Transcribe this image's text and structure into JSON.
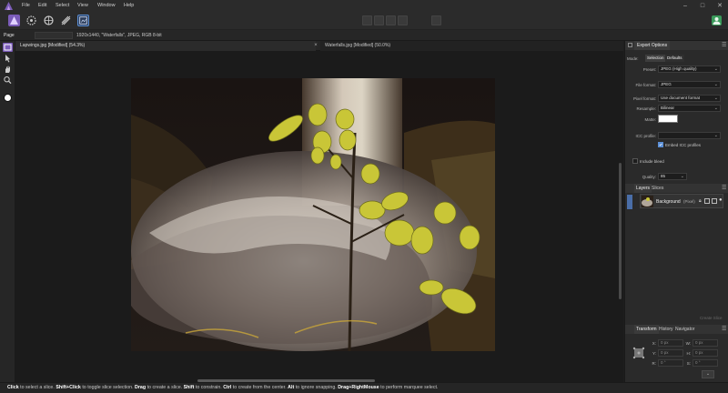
{
  "menu": {
    "items": [
      "File",
      "Edit",
      "Select",
      "View",
      "Window",
      "Help"
    ]
  },
  "window_controls": {
    "minimize": "–",
    "maximize": "□",
    "close": "✕"
  },
  "context_bar": {
    "persona_label": "Page",
    "document_info": "1920x1440, \"Waterfalls\", JPEG, RGB 8-bit"
  },
  "documents": {
    "tabs": [
      {
        "label": "Lapwings.jpg [Modified] (54.3%)"
      },
      {
        "label": "Waterfalls.jpg [Modified] (50.0%)"
      }
    ]
  },
  "export_options": {
    "tab_label": "Export Options",
    "mode_label": "Mode:",
    "mode_selection": "Selection",
    "mode_defaults": "Defaults",
    "preset_label": "Preset:",
    "preset_value": "JPEG (High quality)",
    "file_format_label": "File format:",
    "file_format_value": "JPEG",
    "pixel_format_label": "Pixel format:",
    "pixel_format_value": "Use document format",
    "resample_label": "Resample:",
    "resample_value": "Bilinear",
    "matte_label": "Matte:",
    "icc_label": "ICC profile:",
    "embed_icc_label": "Embed ICC profiles",
    "include_bleed_label": "Include bleed",
    "quality_label": "Quality:",
    "quality_value": "85"
  },
  "layers_panel": {
    "tabs": [
      "Layers",
      "Slices"
    ],
    "layer_name": "Background",
    "layer_type": "(Pixel)",
    "footer_button": "Create Slice"
  },
  "transform_panel": {
    "tabs": [
      "Transform",
      "History",
      "Navigator"
    ],
    "x_label": "X:",
    "x_value": "0 px",
    "y_label": "Y:",
    "y_value": "0 px",
    "w_label": "W:",
    "w_value": "0 px",
    "h_label": "H:",
    "h_value": "0 px",
    "r_label": "R:",
    "r_value": "0 °",
    "s_label": "S:",
    "s_value": "0 °"
  },
  "status": {
    "segments": [
      {
        "b": "Click",
        "t": " to select a slice. "
      },
      {
        "b": "Shift+Click",
        "t": " to toggle slice selection. "
      },
      {
        "b": "Drag",
        "t": " to create a slice. "
      },
      {
        "b": "Shift",
        "t": " to constrain. "
      },
      {
        "b": "Ctrl",
        "t": " to create from the center. "
      },
      {
        "b": "Alt",
        "t": " to ignore snapping. "
      },
      {
        "b": "Drag+RightMouse",
        "t": " to perform marquee select."
      }
    ]
  },
  "colors": {
    "accent": "#5b8fd6",
    "persona_active": "#7b5cb8",
    "user_icon": "#3a9a5a"
  }
}
